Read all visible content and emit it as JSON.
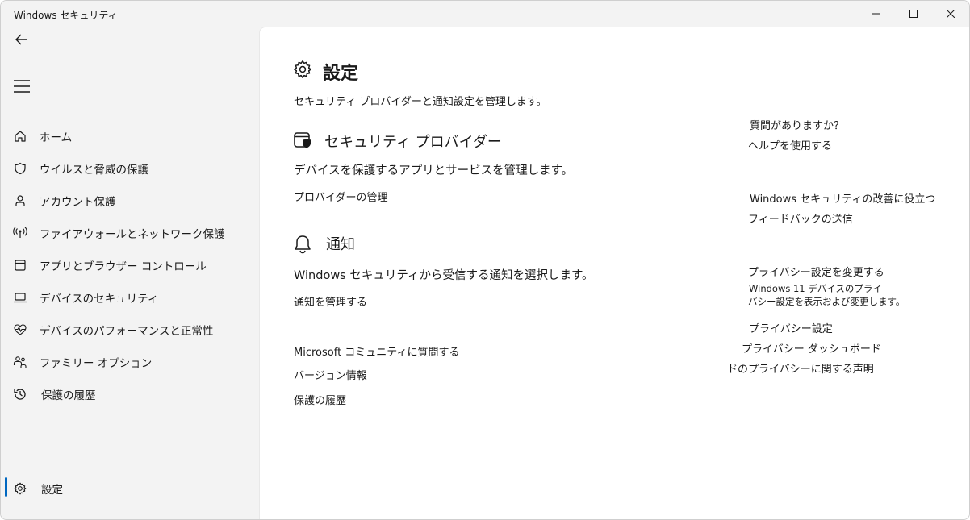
{
  "window": {
    "title": "Windows セキュリティ"
  },
  "sidebar": {
    "items": [
      {
        "label": "ホーム",
        "icon": "home-icon"
      },
      {
        "label": "ウイルスと脅威の保護",
        "icon": "shield-icon"
      },
      {
        "label": "アカウント保護",
        "icon": "person-icon"
      },
      {
        "label": "ファイアウォールとネットワーク保護",
        "icon": "antenna-icon"
      },
      {
        "label": "アプリとブラウザー コントロール",
        "icon": "browser-window-icon"
      },
      {
        "label": "デバイスのセキュリティ",
        "icon": "laptop-icon"
      },
      {
        "label": "デバイスのパフォーマンスと正常性",
        "icon": "heart-pulse-icon"
      },
      {
        "label": "ファミリー オプション",
        "icon": "family-icon"
      },
      {
        "label": "保護の履歴",
        "icon": "history-icon"
      }
    ],
    "settings": {
      "label": "設定",
      "icon": "gear-icon",
      "selected": true
    },
    "accent_color": "#0067c0"
  },
  "main": {
    "title": "設定",
    "subtitle": "セキュリティ プロバイダーと通知設定を管理します。",
    "providers": {
      "title": "セキュリティ プロバイダー",
      "description": "デバイスを保護するアプリとサービスを管理します。",
      "link": "プロバイダーの管理"
    },
    "notifications": {
      "title": "通知",
      "description": "Windows セキュリティから受信する通知を選択します。",
      "link": "通知を管理する"
    },
    "links": {
      "community": "Microsoft コミュニティに質問する",
      "version": "バージョン情報",
      "history": "保護の履歴"
    }
  },
  "right": {
    "question": {
      "heading": "質問がありますか？",
      "link": "ヘルプを使用する"
    },
    "improve": {
      "heading": "Windows セキュリティの改善に役立つ",
      "link": "フィードバックの送信"
    },
    "privacy": {
      "heading": "プライバシー設定を変更する",
      "desc_line1": "Windows 11 デバイスのプライ",
      "desc_line2": "バシー設定を表示および変更します。",
      "links": [
        "プライバシー設定",
        "プライバシー ダッシュボード",
        "ドのプライバシーに関する声明"
      ]
    }
  }
}
